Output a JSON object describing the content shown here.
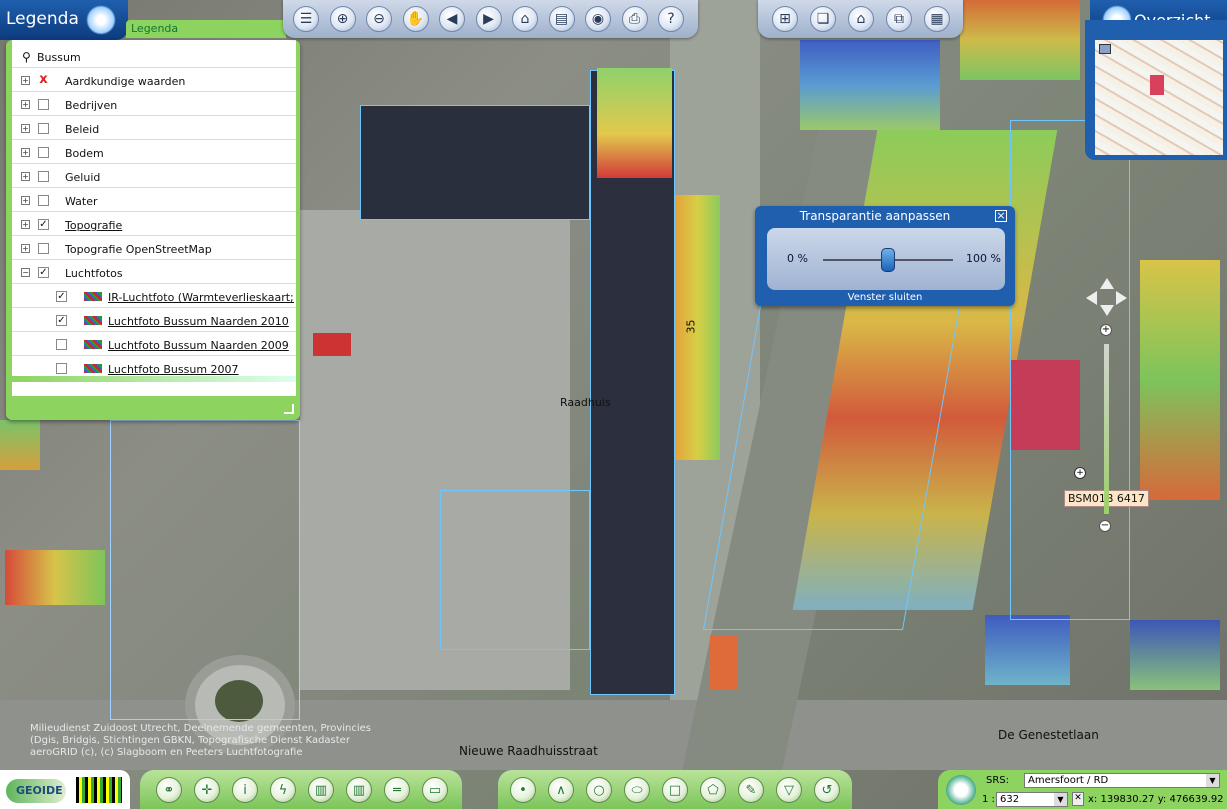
{
  "legend": {
    "title": "Legenda",
    "tab_label": "Legenda",
    "root": "Bussum",
    "items": [
      {
        "label": "Aardkundige waarden",
        "checked": "x",
        "expand": "+",
        "link": false
      },
      {
        "label": "Bedrijven",
        "checked": "",
        "expand": "+",
        "link": false
      },
      {
        "label": "Beleid",
        "checked": "",
        "expand": "+",
        "link": false
      },
      {
        "label": "Bodem",
        "checked": "",
        "expand": "+",
        "link": false
      },
      {
        "label": "Geluid",
        "checked": "",
        "expand": "+",
        "link": false
      },
      {
        "label": "Water",
        "checked": "",
        "expand": "+",
        "link": false
      },
      {
        "label": "Topografie",
        "checked": "✓",
        "expand": "+",
        "link": true
      },
      {
        "label": "Topografie OpenStreetMap",
        "checked": "",
        "expand": "+",
        "link": false
      },
      {
        "label": "Luchtfotos",
        "checked": "✓",
        "expand": "−",
        "link": false
      }
    ],
    "sublayers": [
      {
        "label": "IR-Luchtfoto (Warmteverlieskaart; Bus:",
        "checked": "✓"
      },
      {
        "label": "Luchtfoto Bussum Naarden 2010",
        "checked": "✓"
      },
      {
        "label": "Luchtfoto Bussum Naarden 2009",
        "checked": ""
      },
      {
        "label": "Luchtfoto Bussum 2007",
        "checked": ""
      }
    ]
  },
  "overview": {
    "title": "Overzicht"
  },
  "toolbar_top": [
    "menu-icon",
    "zoom-in-icon",
    "zoom-out-icon",
    "pan-hand-icon",
    "back-icon",
    "forward-icon",
    "home-icon",
    "layers-icon",
    "globe-icon",
    "print-icon",
    "help-icon"
  ],
  "toolbar_top2": [
    "add-layer-icon",
    "layer-info-icon",
    "layer-home-icon",
    "copy-icon",
    "grid-icon"
  ],
  "transparency": {
    "title": "Transparantie aanpassen",
    "min_label": "0 %",
    "max_label": "100 %",
    "value": 0.5,
    "close_label": "Venster sluiten"
  },
  "map_labels": {
    "street1": "Nieuwe Raadhuisstraat",
    "street2": "De Genestetlaan",
    "raadhuis": "Raadhuis",
    "house35": "35",
    "parcel": "BSM01B  6417",
    "copyright1": "Milieudienst Zuidoost Utrecht, Deelnemende gemeenten, Provincies",
    "copyright2": "(Dgis, Bridgis, Stichtingen GBKN, Topografische Dienst Kadaster",
    "copyright3": "aeroGRID (c), (c) Slagboom en Peeters Luchtfotografie"
  },
  "bottom": {
    "logo": "GEOIDE",
    "srs_label": "SRS:",
    "srs_value": "Amersfoort / RD",
    "scale_prefix": "1 :",
    "scale_value": "632",
    "coords": "x: 139830.27 y: 476639.92"
  }
}
